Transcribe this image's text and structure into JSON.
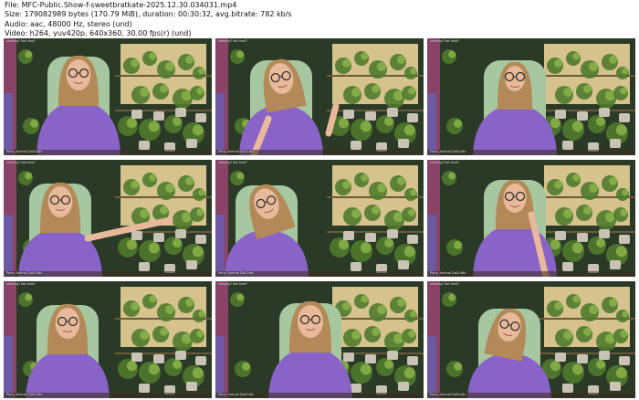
{
  "file_info": {
    "file": "File: MFC-Public.Show-f-sweetbratkate-2025.12.30.034031.mp4",
    "size": "Size: 179082989 bytes (170.79 MiB), duration: 00:30:32, avg.bitrate: 782 kb/s",
    "audio": "Audio: aac, 48000 Hz, stereo (und)",
    "video": "Video: h264, yuv420p, 640x360, 30.00 fps(r) (und)"
  },
  "colors": {
    "background": "#ffffff",
    "shirt": "#8a63c9",
    "hair": "#b38a57",
    "skin": "#e8b99a",
    "chair": "#a7c7a0",
    "plants": "#4f7a2d",
    "window_light": "#f3dba0",
    "led_pink": "#d9489b",
    "led_blue": "#4d6ee0"
  },
  "thumbnails": [
    {
      "id": 1,
      "label": "sleeping? Not tired?",
      "caption": "Party Animal DaChitlz",
      "pose": "center-smile"
    },
    {
      "id": 2,
      "label": "sleeping? Not tired?",
      "caption": "Party Animal DaChitlz",
      "pose": "laughing-lean-left"
    },
    {
      "id": 3,
      "label": "sleeping? Not tired?",
      "caption": "Party Animal DaChitlz",
      "pose": "center-far"
    },
    {
      "id": 4,
      "label": "sleeping? Not tired?",
      "caption": "Party Animal DaChitlz",
      "pose": "arm-pointing"
    },
    {
      "id": 5,
      "label": "sleeping? Not tired?",
      "caption": "Party Animal DaChitlz",
      "pose": "looking-down-left"
    },
    {
      "id": 6,
      "label": "sleeping? Not tired?",
      "caption": "Party Animal DaChitlz",
      "pose": "hand-on-chin"
    },
    {
      "id": 7,
      "label": "sleeping? Not tired?",
      "caption": "Party Animal DaChitlz",
      "pose": "lean-left"
    },
    {
      "id": 8,
      "label": "sleeping? Not tired?",
      "caption": "Party Animal DaChitlz",
      "pose": "center-close"
    },
    {
      "id": 9,
      "label": "sleeping? Not tired?",
      "caption": "Party Animal DaChitlz",
      "pose": "head-tilt"
    }
  ]
}
